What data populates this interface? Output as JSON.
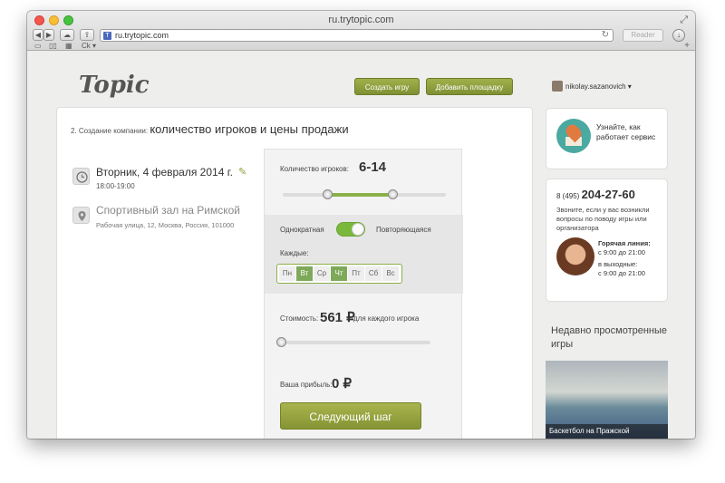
{
  "window": {
    "title": "ru.trytopic.com",
    "url": "ru.trytopic.com",
    "reader_label": "Reader",
    "bookmark_label": "Ck ▾"
  },
  "header": {
    "logo": "Topic",
    "create_game": "Создать игру",
    "add_venue": "Добавить площадку",
    "username": "nikolay.sazanovich ▾"
  },
  "main": {
    "step_prefix": "2. Создание компании: ",
    "step_title": "количество игроков и цены продажи",
    "date": "Вторник, 4 февраля 2014 г.",
    "time": "18:00-19:00",
    "venue": "Спортивный зал на Римской",
    "address": "Рабочая улица, 12, Москва, Россия, 101000"
  },
  "panel": {
    "players_label": "Количество игроков:",
    "players_value": "6-14",
    "players_range": [
      0.28,
      0.68
    ],
    "once_label": "Однократная",
    "repeat_label": "Повторяющаяся",
    "every_label": "Каждые:",
    "days": [
      {
        "label": "Пн",
        "on": false
      },
      {
        "label": "Вт",
        "on": true
      },
      {
        "label": "Ср",
        "on": false
      },
      {
        "label": "Чт",
        "on": true
      },
      {
        "label": "Пт",
        "on": false
      },
      {
        "label": "Сб",
        "on": false
      },
      {
        "label": "Вс",
        "on": false
      }
    ],
    "price_label": "Стоимость:",
    "price_value": "561 ₽",
    "price_suffix": "для каждого игрока",
    "profit_label": "Ваша прибыль:",
    "profit_value": "0 ₽",
    "next_button": "Следующий шаг"
  },
  "sidebar": {
    "help_text": "Узнайте, как работает сервис",
    "phone_prefix": "8 (495) ",
    "phone_number": "204-27-60",
    "phone_desc": "Звоните, если у вас возникли вопросы по поводу игры или организатора",
    "hotline_label": "Горячая линия:",
    "hotline_hours": "с 9:00 до 21:00",
    "weekend_label": "в выходные:",
    "weekend_hours": "с 9:00 до 21:00",
    "recent_title": "Недавно просмотренные игры",
    "recent_game": "Баскетбол на Пражской"
  },
  "colors": {
    "accent_green": "#8ab04a",
    "button_green": "#869434"
  }
}
